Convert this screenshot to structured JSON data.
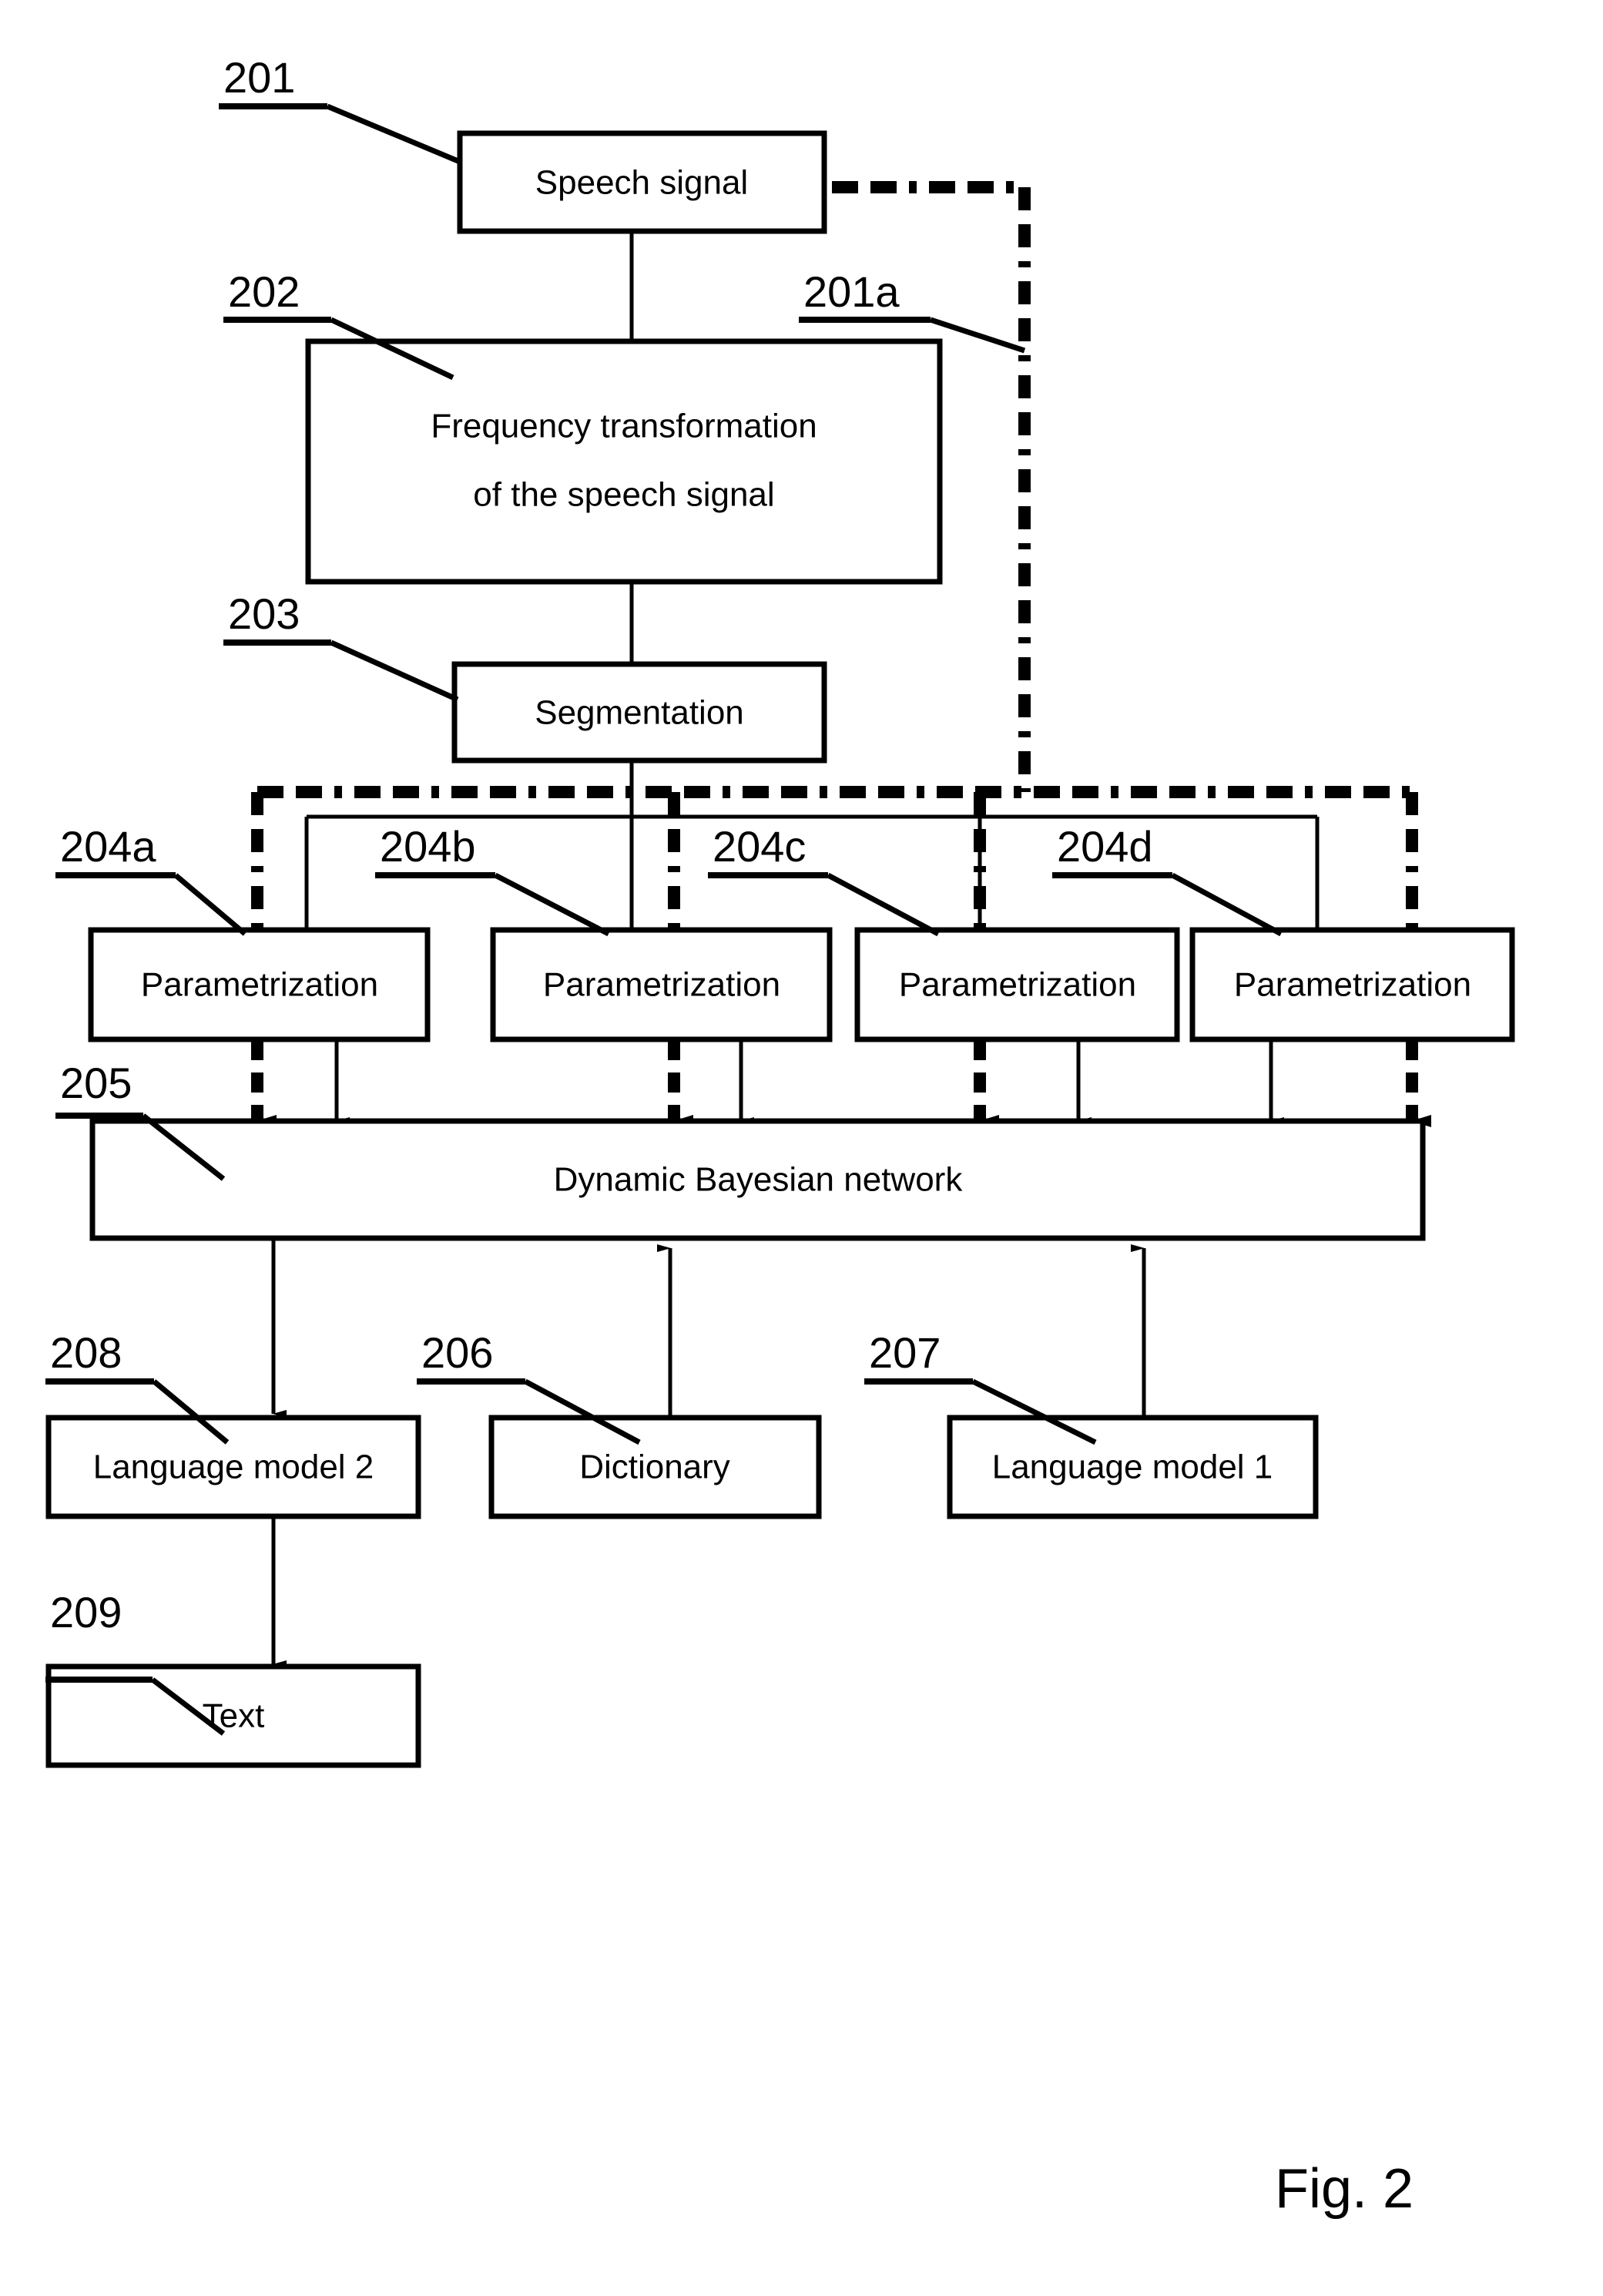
{
  "figure": {
    "caption": "Fig. 2",
    "background": "#ffffff",
    "ink": "#000000"
  },
  "nodes": {
    "speech_signal": {
      "ref": "201",
      "label": "Speech signal"
    },
    "frequency_transformation": {
      "ref": "202",
      "label_line1": "Frequency transformation",
      "label_line2": "of the speech signal"
    },
    "segmentation": {
      "ref": "203",
      "label": "Segmentation"
    },
    "parametrization_a": {
      "ref": "204a",
      "label": "Parametrization"
    },
    "parametrization_b": {
      "ref": "204b",
      "label": "Parametrization"
    },
    "parametrization_c": {
      "ref": "204c",
      "label": "Parametrization"
    },
    "parametrization_d": {
      "ref": "204d",
      "label": "Parametrization"
    },
    "dynamic_bayesian_network": {
      "ref": "205",
      "label": "Dynamic Bayesian network"
    },
    "dictionary": {
      "ref": "206",
      "label": "Dictionary"
    },
    "language_model_1": {
      "ref": "207",
      "label": "Language model 1"
    },
    "language_model_2": {
      "ref": "208",
      "label": "Language model 2"
    },
    "text": {
      "ref": "209",
      "label": "Text"
    }
  },
  "connections": {
    "raw_signal_bus": {
      "ref": "201a",
      "style": "dash-dot"
    }
  },
  "ref_labels": [
    "201",
    "201a",
    "202",
    "203",
    "204a",
    "204b",
    "204c",
    "204d",
    "205",
    "206",
    "207",
    "208",
    "209"
  ]
}
